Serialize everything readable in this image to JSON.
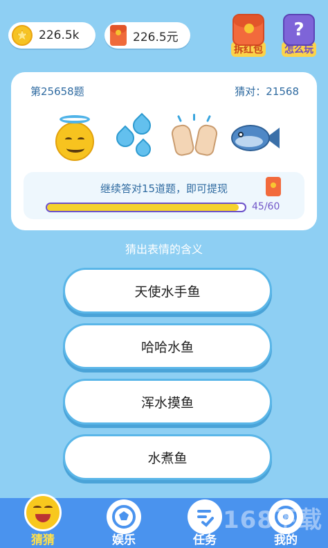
{
  "top": {
    "coins": "226.5k",
    "money": "226.5元",
    "red_packet_label": "拆红包",
    "help_label": "怎么玩",
    "help_glyph": "?"
  },
  "card": {
    "question_number": "第25658题",
    "guess_count": "猜对：21568",
    "emojis": [
      "smiling-face-with-halo",
      "sweat-droplets",
      "raising-hands",
      "fish"
    ],
    "progress": {
      "title": "继续答对15道题，即可提现",
      "count": "45/60",
      "fraction": 0.97
    }
  },
  "subtitle": "猜出表情的含义",
  "options": [
    "天使水手鱼",
    "哈哈水鱼",
    "浑水摸鱼",
    "水煮鱼"
  ],
  "nav": {
    "items": [
      "猜猜",
      "娱乐",
      "任务",
      "我的"
    ],
    "active": 0
  },
  "watermark": "168下载",
  "colors": {
    "background": "#8ecff3",
    "nav": "#4a93ee",
    "accent_yellow": "#f5d22c",
    "purple": "#6a50c9"
  }
}
